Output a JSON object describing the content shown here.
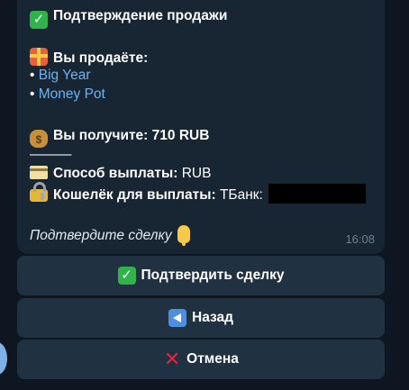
{
  "message": {
    "title": "Подтверждение продажи",
    "selling_label": "Вы продаёте:",
    "items": [
      "Big Year",
      "Money Pot"
    ],
    "bullet": "•",
    "receive_label": "Вы получите: 710 RUB",
    "divider": "———",
    "payout_method_label": "Способ выплаты:",
    "payout_method_value": "RUB",
    "wallet_label": "Кошелёк для выплаты:",
    "wallet_value": "ТБанк:",
    "confirm_prompt": "Подтвердите сделку",
    "time": "16:08"
  },
  "buttons": {
    "confirm": "Подтвердить сделку",
    "back": "Назад",
    "cancel": "Отмена"
  },
  "icons": {
    "title": "check-mark-emoji",
    "selling": "gift-emoji",
    "receive": "money-bag-emoji",
    "payout": "credit-card-emoji",
    "wallet": "lock-with-key-emoji",
    "prompt": "pointing-down-emoji",
    "back": "back-arrow-emoji",
    "cancel": "cross-mark-emoji"
  },
  "colors": {
    "background": "#0e1621",
    "bubble": "#182533",
    "button": "#203142",
    "link": "#6ab3f3",
    "timestamp": "#6d7f8f"
  }
}
